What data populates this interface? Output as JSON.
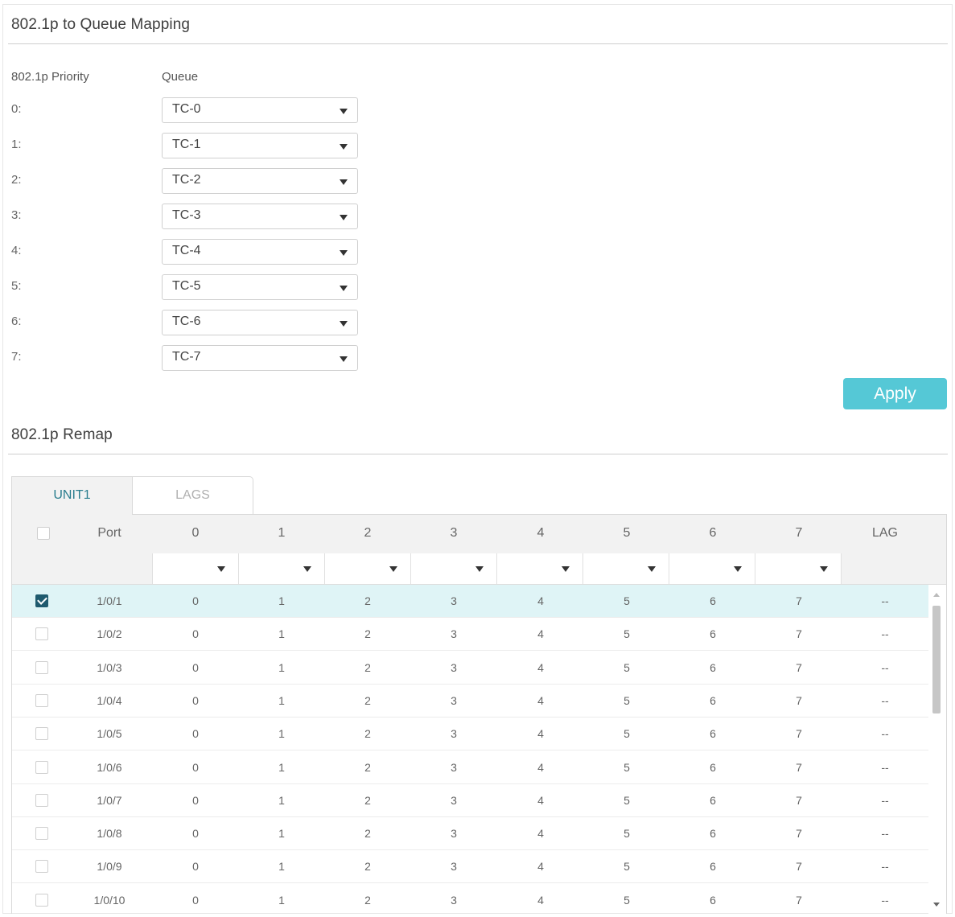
{
  "mapping": {
    "title": "802.1p to Queue Mapping",
    "col_priority": "802.1p Priority",
    "col_queue": "Queue",
    "rows": [
      {
        "priority": "0:",
        "queue": "TC-0"
      },
      {
        "priority": "1:",
        "queue": "TC-1"
      },
      {
        "priority": "2:",
        "queue": "TC-2"
      },
      {
        "priority": "3:",
        "queue": "TC-3"
      },
      {
        "priority": "4:",
        "queue": "TC-4"
      },
      {
        "priority": "5:",
        "queue": "TC-5"
      },
      {
        "priority": "6:",
        "queue": "TC-6"
      },
      {
        "priority": "7:",
        "queue": "TC-7"
      }
    ],
    "apply_label": "Apply"
  },
  "remap": {
    "title": "802.1p Remap",
    "tabs": [
      {
        "label": "UNIT1",
        "active": true
      },
      {
        "label": "LAGS",
        "active": false
      }
    ],
    "headers": [
      "Port",
      "0",
      "1",
      "2",
      "3",
      "4",
      "5",
      "6",
      "7",
      "LAG"
    ],
    "filter_values": [
      "",
      "",
      "",
      "",
      "",
      "",
      "",
      ""
    ],
    "rows": [
      {
        "checked": true,
        "cells": [
          "1/0/1",
          "0",
          "1",
          "2",
          "3",
          "4",
          "5",
          "6",
          "7",
          "--"
        ]
      },
      {
        "checked": false,
        "cells": [
          "1/0/2",
          "0",
          "1",
          "2",
          "3",
          "4",
          "5",
          "6",
          "7",
          "--"
        ]
      },
      {
        "checked": false,
        "cells": [
          "1/0/3",
          "0",
          "1",
          "2",
          "3",
          "4",
          "5",
          "6",
          "7",
          "--"
        ]
      },
      {
        "checked": false,
        "cells": [
          "1/0/4",
          "0",
          "1",
          "2",
          "3",
          "4",
          "5",
          "6",
          "7",
          "--"
        ]
      },
      {
        "checked": false,
        "cells": [
          "1/0/5",
          "0",
          "1",
          "2",
          "3",
          "4",
          "5",
          "6",
          "7",
          "--"
        ]
      },
      {
        "checked": false,
        "cells": [
          "1/0/6",
          "0",
          "1",
          "2",
          "3",
          "4",
          "5",
          "6",
          "7",
          "--"
        ]
      },
      {
        "checked": false,
        "cells": [
          "1/0/7",
          "0",
          "1",
          "2",
          "3",
          "4",
          "5",
          "6",
          "7",
          "--"
        ]
      },
      {
        "checked": false,
        "cells": [
          "1/0/8",
          "0",
          "1",
          "2",
          "3",
          "4",
          "5",
          "6",
          "7",
          "--"
        ]
      },
      {
        "checked": false,
        "cells": [
          "1/0/9",
          "0",
          "1",
          "2",
          "3",
          "4",
          "5",
          "6",
          "7",
          "--"
        ]
      },
      {
        "checked": false,
        "cells": [
          "1/0/10",
          "0",
          "1",
          "2",
          "3",
          "4",
          "5",
          "6",
          "7",
          "--"
        ]
      }
    ]
  },
  "colors": {
    "accent": "#55c8d6",
    "checkbox_checked": "#1f5a6e",
    "selected_row": "#dff4f6",
    "active_tab_text": "#2a7d8e"
  },
  "icons": {
    "dropdown": "caret-down-icon",
    "checkbox": "checkbox-icon",
    "scroll_up": "scroll-up-icon",
    "scroll_down": "scroll-down-icon"
  }
}
